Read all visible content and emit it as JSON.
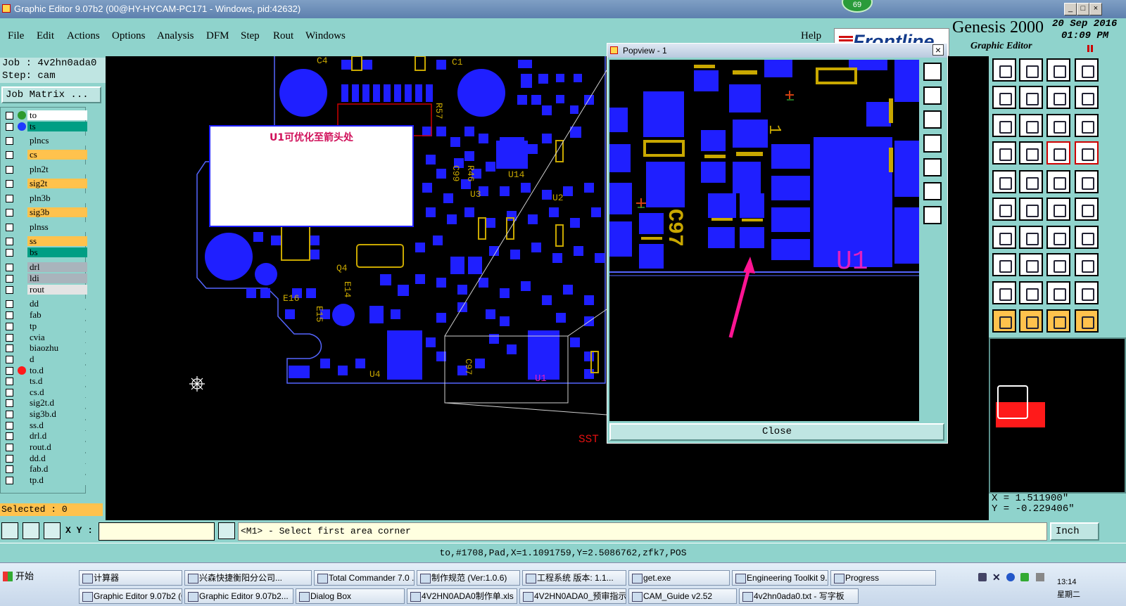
{
  "window": {
    "title": "Graphic Editor 9.07b2 (00@HY-HYCAM-PC171 - Windows, pid:42632)",
    "badge": "69"
  },
  "menu": {
    "items": [
      "File",
      "Edit",
      "Actions",
      "Options",
      "Analysis",
      "DFM",
      "Step",
      "Rout",
      "Windows"
    ],
    "help": "Help"
  },
  "brand": {
    "logo": "Frontline",
    "product": "Genesis 2000",
    "subtitle": "Graphic Editor",
    "date": "20 Sep 2016",
    "time": "01:09 PM"
  },
  "left": {
    "job": "Job : 4v2hn0ada0",
    "step": "Step: cam",
    "matrix_button": "Job Matrix ...",
    "selected": "Selected : 0",
    "layers": [
      {
        "name": "to",
        "bg": "#ffffff",
        "dot": "#2e9a2e"
      },
      {
        "name": "ts",
        "bg": "#009e84",
        "dot": "#1f3bff"
      },
      {
        "name": "plncs",
        "bg": "#8fd3cc",
        "dot": ""
      },
      {
        "name": "cs",
        "bg": "#ffc24d",
        "dot": ""
      },
      {
        "name": "pln2t",
        "bg": "#8fd3cc",
        "dot": ""
      },
      {
        "name": "sig2t",
        "bg": "#ffc24d",
        "dot": ""
      },
      {
        "name": "pln3b",
        "bg": "#8fd3cc",
        "dot": ""
      },
      {
        "name": "sig3b",
        "bg": "#ffc24d",
        "dot": ""
      },
      {
        "name": "plnss",
        "bg": "#8fd3cc",
        "dot": ""
      },
      {
        "name": "ss",
        "bg": "#ffc24d",
        "dot": ""
      },
      {
        "name": "bs",
        "bg": "#009e84",
        "dot": ""
      },
      {
        "name": "drl",
        "bg": "#a9b4bc",
        "dot": ""
      },
      {
        "name": "ldi",
        "bg": "#a9b4bc",
        "dot": ""
      },
      {
        "name": "rout",
        "bg": "#e4e4e4",
        "dot": ""
      },
      {
        "name": "dd",
        "bg": "#8fd3cc",
        "dot": ""
      },
      {
        "name": "fab",
        "bg": "#8fd3cc",
        "dot": ""
      },
      {
        "name": "tp",
        "bg": "#8fd3cc",
        "dot": ""
      },
      {
        "name": "cvia",
        "bg": "#8fd3cc",
        "dot": ""
      },
      {
        "name": "biaozhu",
        "bg": "#8fd3cc",
        "dot": ""
      },
      {
        "name": "d",
        "bg": "#8fd3cc",
        "dot": ""
      },
      {
        "name": "to.d",
        "bg": "#8fd3cc",
        "dot": "#ff1a1a"
      },
      {
        "name": "ts.d",
        "bg": "#8fd3cc",
        "dot": ""
      },
      {
        "name": "cs.d",
        "bg": "#8fd3cc",
        "dot": ""
      },
      {
        "name": "sig2t.d",
        "bg": "#8fd3cc",
        "dot": ""
      },
      {
        "name": "sig3b.d",
        "bg": "#8fd3cc",
        "dot": ""
      },
      {
        "name": "ss.d",
        "bg": "#8fd3cc",
        "dot": ""
      },
      {
        "name": "drl.d",
        "bg": "#8fd3cc",
        "dot": ""
      },
      {
        "name": "rout.d",
        "bg": "#8fd3cc",
        "dot": ""
      },
      {
        "name": "dd.d",
        "bg": "#8fd3cc",
        "dot": ""
      },
      {
        "name": "fab.d",
        "bg": "#8fd3cc",
        "dot": ""
      },
      {
        "name": "tp.d",
        "bg": "#8fd3cc",
        "dot": ""
      }
    ]
  },
  "canvas": {
    "note": "U1可优化至箭头处",
    "labels": {
      "c4": "C4",
      "c1": "C1",
      "r57": "R57",
      "r46": "R46",
      "c99": "C99",
      "u14": "U14",
      "u3": "U3",
      "u2": "U2",
      "q4": "Q4",
      "e14": "E14",
      "e16": "E16",
      "e15": "E15",
      "u4": "U4",
      "c97": "C97",
      "u1": "U1",
      "sst": "SST"
    }
  },
  "popview": {
    "title": "Popview - 1",
    "close": "Close",
    "c97": "C97",
    "u1": "U1",
    "one": "1"
  },
  "right": {
    "x": "X =  1.511900\"",
    "y": "Y = -0.229406\""
  },
  "command": {
    "xy_label": "X Y :",
    "xy_value": "",
    "prompt": "<M1> - Select first area corner",
    "units": "Inch"
  },
  "status": "to,#1708,Pad,X=1.1091759,Y=2.5086762,zfk7,POS",
  "taskbar": {
    "start": "开始",
    "row1": [
      "计算器",
      "兴森快捷衡阳分公司...",
      "Total Commander 7.0 ...",
      "制作规范 (Ver:1.0.6)",
      "工程系统  版本: 1.1...",
      "get.exe",
      "Engineering Toolkit 9.0...",
      "Progress"
    ],
    "row2": [
      "Graphic Editor 9.07b2 (0...",
      "Graphic Editor 9.07b2...",
      "Dialog Box",
      "4V2HN0ADA0制作单.xls",
      "4V2HN0ADA0_预审指示...",
      "CAM_Guide v2.52",
      "4v2hn0ada0.txt - 写字板"
    ],
    "clock": "13:14",
    "day": "星期二"
  }
}
